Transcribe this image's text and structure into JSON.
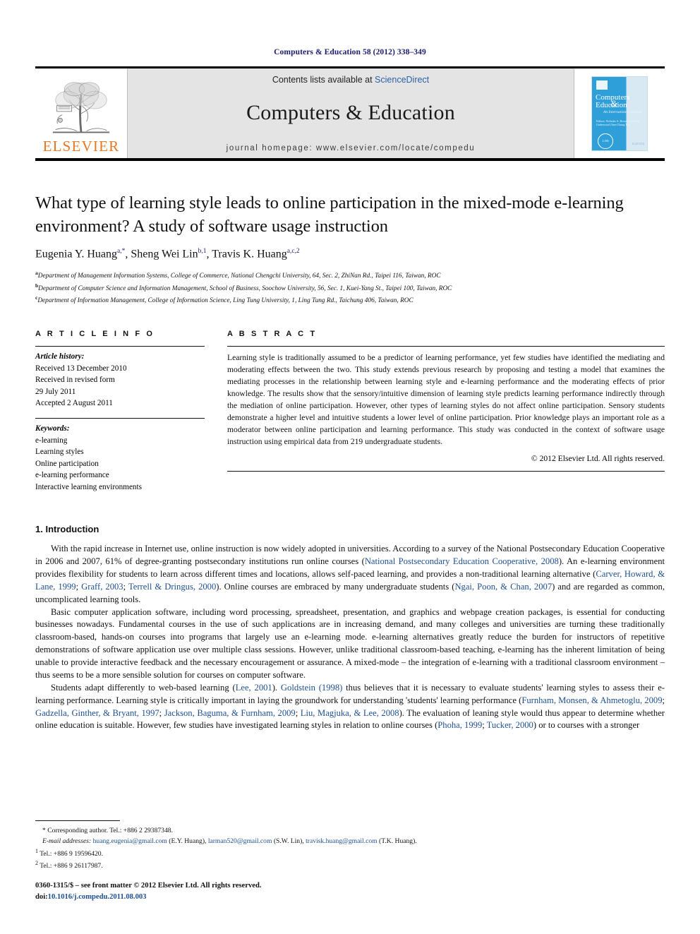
{
  "running_head": "Computers & Education 58 (2012) 338–349",
  "masthead": {
    "publisher_wordmark": "ELSEVIER",
    "contents_prefix": "Contents lists available at ",
    "contents_link": "ScienceDirect",
    "journal_title": "Computers & Education",
    "homepage": "journal homepage: www.elsevier.com/locate/compedu",
    "cover": {
      "line1": "Computers",
      "line2": "Education",
      "amp": "&",
      "subtitle": "An International Journal",
      "editors": "Editors:\nNicholas A. Bowen\nJean D.M. Underwood\nChen-Chung Tsai",
      "badge": "2.190",
      "publisher": "ELSEVIER"
    }
  },
  "article": {
    "title": "What type of learning style leads to online participation in the mixed-mode e-learning environment? A study of software usage instruction",
    "authors_parts": [
      {
        "name": "Eugenia Y. Huang",
        "sup": "a,*"
      },
      {
        "name": "Sheng Wei Lin",
        "sup": "b,1"
      },
      {
        "name": "Travis K. Huang",
        "sup": "a,c,2"
      }
    ],
    "affiliations": [
      {
        "mark": "a",
        "text": "Department of Management Information Systems, College of Commerce, National Chengchi University, 64, Sec. 2, ZhiNan Rd., Taipei 116, Taiwan, ROC"
      },
      {
        "mark": "b",
        "text": "Department of Computer Science and Information Management, School of Business, Soochow University, 56, Sec. 1, Kuei-Yang St., Taipei 100, Taiwan, ROC"
      },
      {
        "mark": "c",
        "text": "Department of Information Management, College of Information Science, Ling Tung University, 1, Ling Tung Rd., Taichung 406, Taiwan, ROC"
      }
    ]
  },
  "article_info": {
    "heading": "A R T I C L E   I N F O",
    "history_label": "Article history:",
    "history_lines": [
      "Received 13 December 2010",
      "Received in revised form",
      "29 July 2011",
      "Accepted 2 August 2011"
    ],
    "keywords_label": "Keywords:",
    "keywords": [
      "e-learning",
      "Learning styles",
      "Online participation",
      "e-learning performance",
      "Interactive learning environments"
    ]
  },
  "abstract": {
    "heading": "A B S T R A C T",
    "text": "Learning style is traditionally assumed to be a predictor of learning performance, yet few studies have identified the mediating and moderating effects between the two. This study extends previous research by proposing and testing a model that examines the mediating processes in the relationship between learning style and e-learning performance and the moderating effects of prior knowledge. The results show that the sensory/intuitive dimension of learning style predicts learning performance indirectly through the mediation of online participation. However, other types of learning styles do not affect online participation. Sensory students demonstrate a higher level and intuitive students a lower level of online participation. Prior knowledge plays an important role as a moderator between online participation and learning performance. This study was conducted in the context of software usage instruction using empirical data from 219 undergraduate students.",
    "copyright": "© 2012 Elsevier Ltd. All rights reserved."
  },
  "introduction": {
    "heading": "1. Introduction",
    "paragraphs": [
      "With the rapid increase in Internet use, online instruction is now widely adopted in universities. According to a survey of the National Postsecondary Education Cooperative in 2006 and 2007, 61% of degree-granting postsecondary institutions run online courses (National Postsecondary Education Cooperative, 2008). An e-learning environment provides flexibility for students to learn across different times and locations, allows self-paced learning, and provides a non-traditional learning alternative (Carver, Howard, & Lane, 1999; Graff, 2003; Terrell & Dringus, 2000). Online courses are embraced by many undergraduate students (Ngai, Poon, & Chan, 2007) and are regarded as common, uncomplicated learning tools.",
      "Basic computer application software, including word processing, spreadsheet, presentation, and graphics and webpage creation packages, is essential for conducting businesses nowadays. Fundamental courses in the use of such applications are in increasing demand, and many colleges and universities are turning these traditionally classroom-based, hands-on courses into programs that largely use an e-learning mode. e-learning alternatives greatly reduce the burden for instructors of repetitive demonstrations of software application use over multiple class sessions. However, unlike traditional classroom-based teaching, e-learning has the inherent limitation of being unable to provide interactive feedback and the necessary encouragement or assurance. A mixed-mode – the integration of e-learning with a traditional classroom environment – thus seems to be a more sensible solution for courses on computer software.",
      "Students adapt differently to web-based learning (Lee, 2001). Goldstein (1998) thus believes that it is necessary to evaluate students' learning styles to assess their e-learning performance. Learning style is critically important in laying the groundwork for understanding 'students' learning performance (Furnham, Monsen, & Ahmetoglu, 2009; Gadzella, Ginther, & Bryant, 1997; Jackson, Baguma, & Furnham, 2009; Liu, Magjuka, & Lee, 2008). The evaluation of leaning style would thus appear to determine whether online education is suitable. However, few studies have investigated learning styles in relation to online courses (Phoha, 1999; Tucker, 2000) or to courses with a stronger"
    ]
  },
  "footnotes": {
    "corresponding": "* Corresponding author. Tel.: +886 2 29387348.",
    "email_label": "E-mail addresses:",
    "emails": [
      {
        "address": "huang.eugenia@gmail.com",
        "owner": "(E.Y. Huang)"
      },
      {
        "address": "larman520@gmail.com",
        "owner": "(S.W. Lin)"
      },
      {
        "address": "travisk.huang@gmail.com",
        "owner": "(T.K. Huang)"
      }
    ],
    "tel1_mark": "1",
    "tel1": "Tel.: +886 9 19596420.",
    "tel2_mark": "2",
    "tel2": "Tel.: +886 9 26117987."
  },
  "colophon": {
    "line1": "0360-1315/$ – see front matter © 2012 Elsevier Ltd. All rights reserved.",
    "doi_prefix": "doi:",
    "doi": "10.1016/j.compedu.2011.08.003"
  }
}
